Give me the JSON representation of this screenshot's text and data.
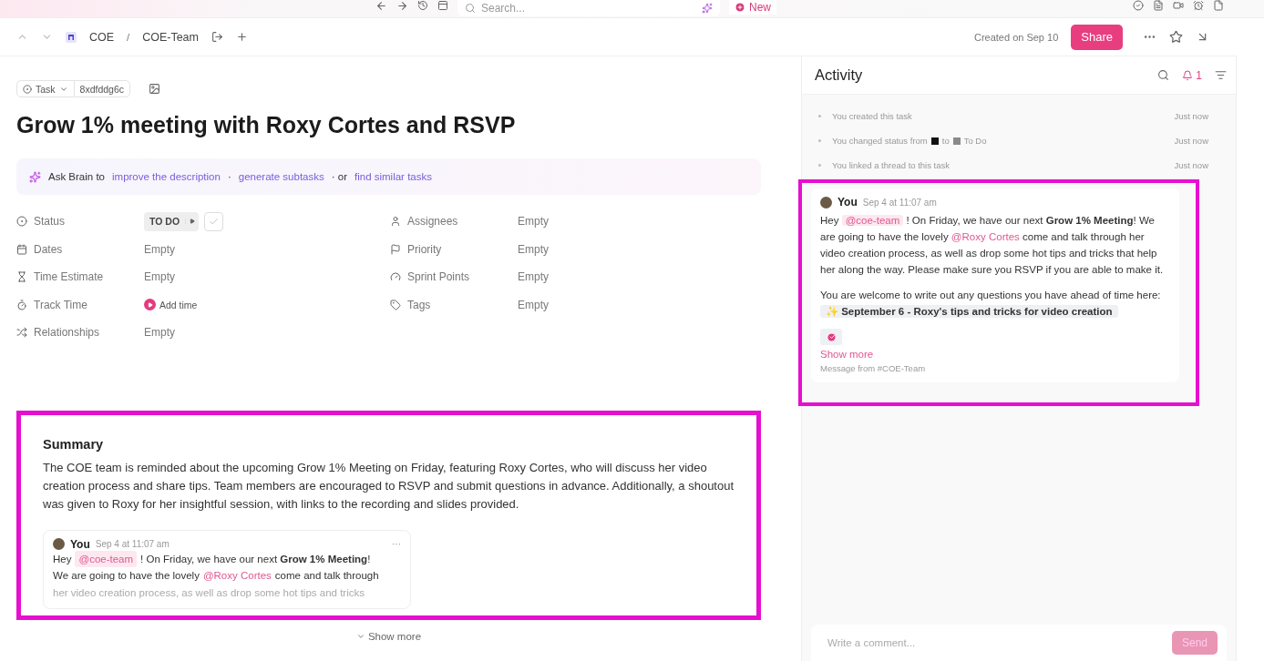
{
  "top_bar": {
    "search": {
      "placeholder": "Search..."
    },
    "new_button": "New"
  },
  "header": {
    "breadcrumb": [
      "COE",
      "COE-Team"
    ],
    "separator": "/",
    "created": "Created on Sep 10",
    "share": "Share"
  },
  "task": {
    "type": "Task",
    "id": "8xdfddg6c",
    "title": "Grow 1% meeting with Roxy Cortes and RSVP",
    "brain": {
      "prefix": "Ask Brain to",
      "links": [
        {
          "text": "improve the description",
          "sep": "·"
        },
        {
          "text": "generate subtasks",
          "sep": "· or"
        },
        {
          "text": "find similar tasks"
        }
      ]
    },
    "fields_left": [
      {
        "kind": "status",
        "label": "Status",
        "value": "TO DO",
        "done": false
      },
      {
        "kind": "empty",
        "label": "Dates",
        "value": "Empty"
      },
      {
        "kind": "empty",
        "label": "Time Estimate",
        "value": "Empty"
      },
      {
        "kind": "add_time",
        "label": "Track Time",
        "value": "Add time"
      },
      {
        "kind": "empty",
        "label": "Relationships",
        "value": "Empty"
      }
    ],
    "fields_right": [
      {
        "kind": "empty",
        "label": "Assignees",
        "value": "Empty"
      },
      {
        "kind": "empty",
        "label": "Priority",
        "value": "Empty"
      },
      {
        "kind": "empty",
        "label": "Sprint Points",
        "value": "Empty"
      },
      {
        "kind": "empty",
        "label": "Tags",
        "value": "Empty"
      }
    ]
  },
  "summary": {
    "highlighted": true,
    "title": "Summary",
    "text": "The COE team is reminded about the upcoming Grow 1% Meeting on Friday, featuring Roxy Cortes, who will discuss her video creation process and share tips. Team members are encouraged to RSVP and submit questions in advance. Additionally, a shoutout was given to Roxy for her insightful session, with links to the recording and slides provided.",
    "message": {
      "author": "You",
      "time": "Sep 4 at 11:07 am",
      "more": "···",
      "lines": [
        [
          {
            "kind": "text",
            "text": "Hey"
          },
          {
            "kind": "mention",
            "text": "@coe-team"
          },
          {
            "kind": "text",
            "text": "! On Friday, we have our next **Grow 1% Meeting**!"
          }
        ],
        [
          {
            "kind": "text",
            "text": "We are going to have the lovely"
          },
          {
            "kind": "link",
            "text": "@Roxy Cortes"
          },
          {
            "kind": "text",
            "text": "come and talk through"
          }
        ],
        [
          {
            "kind": "faded",
            "text": "her video creation process, as well as drop some hot tips and tricks"
          }
        ]
      ]
    },
    "show_more": "Show more"
  },
  "activity": {
    "title": "Activity",
    "notifications": "1",
    "events": [
      {
        "kind": "plain",
        "text": "You created this task",
        "time": "Just now"
      },
      {
        "kind": "status",
        "text": "You changed status from",
        "mid": "to",
        "statuses": [
          {
            "color": "#111111"
          },
          {
            "color": "#8a8a8a",
            "label": "To Do"
          }
        ],
        "time": "Just now"
      },
      {
        "kind": "plain",
        "text": "You linked a thread to this task",
        "time": "Just now"
      }
    ],
    "thread": {
      "highlighted": true,
      "author": "You",
      "time": "Sep 4 at 11:07 am",
      "paragraphs": [
        [
          {
            "kind": "text",
            "text": "Hey"
          },
          {
            "kind": "mention",
            "text": "@coe-team"
          },
          {
            "kind": "text",
            "text": "! On Friday, we have our next **Grow 1% Meeting**! We are going to have the lovely"
          },
          {
            "kind": "link",
            "text": "@Roxy Cortes"
          },
          {
            "kind": "text",
            "text": "come and talk through her video creation process, as well as drop some hot tips and tricks that help her along the way. Please make sure you RSVP if you are able to make it."
          }
        ],
        [
          {
            "kind": "text",
            "text": "You are welcome to write out any questions you have ahead of time here:"
          },
          {
            "kind": "doc",
            "text": "✨ September 6 - Roxy's tips and tricks for video creation"
          }
        ]
      ],
      "show_more": "Show more",
      "source": "Message from #COE-Team"
    },
    "comment": {
      "placeholder": "Write a comment...",
      "send": "Send"
    }
  }
}
